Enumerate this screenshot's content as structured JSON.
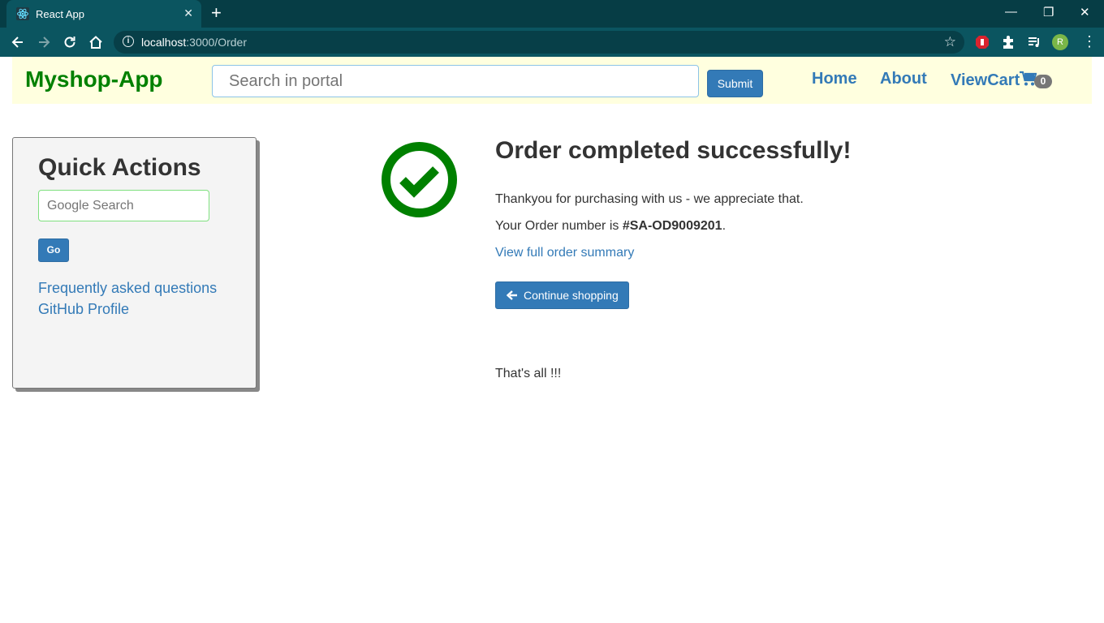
{
  "browser": {
    "tab_title": "React App",
    "tab_close": "✕",
    "new_tab": "+",
    "window_controls": [
      "—",
      "❐",
      "✕"
    ],
    "url_host": "localhost",
    "url_path": ":3000/Order",
    "info_symbol": "i",
    "star_icon": "☆",
    "profile_initial": "R",
    "menu": "⋮"
  },
  "navbar": {
    "brand": "Myshop-App",
    "search_placeholder": "Search in portal",
    "submit_label": "Submit",
    "links": {
      "home": "Home",
      "about": "About",
      "viewcart": "ViewCart"
    },
    "cart_count": "0"
  },
  "sidebar": {
    "title": "Quick Actions",
    "google_placeholder": "Google Search",
    "go_label": "Go",
    "links": [
      "Frequently asked questions",
      "GitHub Profile"
    ]
  },
  "order": {
    "headline": "Order completed successfully!",
    "thanks": "Thankyou for purchasing with us - we appreciate that.",
    "order_prefix": "Your Order number is ",
    "order_number": "#SA-OD9009201",
    "order_suffix": ".",
    "summary_link": "View full order summary",
    "continue_label": "Continue shopping",
    "footer_text": "That's all !!!"
  },
  "colors": {
    "brand": "#008000",
    "link": "#337ab7",
    "success": "#008000",
    "navbar_bg": "#ffffdf"
  }
}
